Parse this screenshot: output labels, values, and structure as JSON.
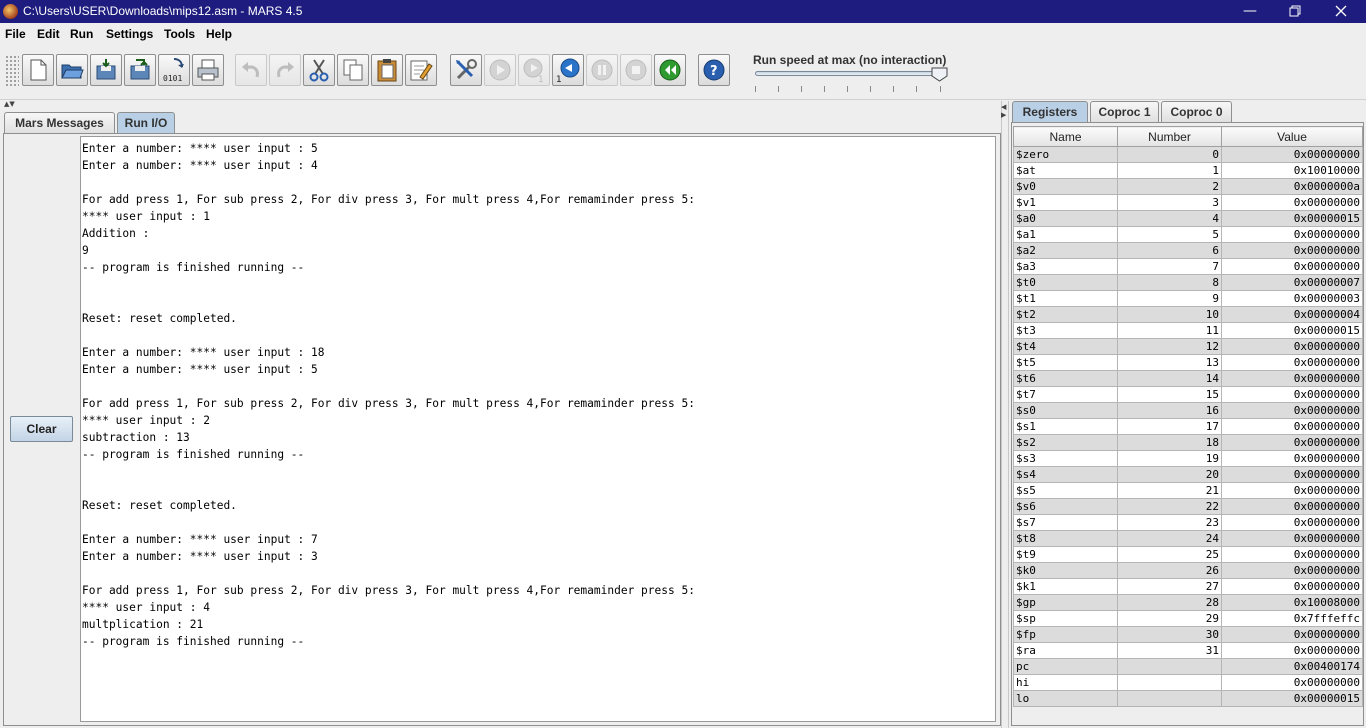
{
  "window": {
    "title": "C:\\Users\\USER\\Downloads\\mips12.asm  - MARS 4.5",
    "controls": [
      "minimize",
      "restore",
      "close"
    ]
  },
  "menu": [
    "File",
    "Edit",
    "Run",
    "Settings",
    "Tools",
    "Help"
  ],
  "toolbar": {
    "buttons": [
      {
        "name": "new-icon",
        "enabled": true
      },
      {
        "name": "open-icon",
        "enabled": true
      },
      {
        "name": "save-icon",
        "enabled": true
      },
      {
        "name": "save-as-icon",
        "enabled": true
      },
      {
        "name": "dump-memory-icon",
        "enabled": true
      },
      {
        "name": "print-icon",
        "enabled": true
      },
      {
        "name": "undo-icon",
        "enabled": false
      },
      {
        "name": "redo-icon",
        "enabled": false
      },
      {
        "name": "cut-icon",
        "enabled": true
      },
      {
        "name": "copy-icon",
        "enabled": true
      },
      {
        "name": "paste-icon",
        "enabled": true
      },
      {
        "name": "find-replace-icon",
        "enabled": true
      },
      {
        "name": "assemble-icon",
        "enabled": true
      },
      {
        "name": "run-icon",
        "enabled": false
      },
      {
        "name": "step-icon",
        "enabled": false
      },
      {
        "name": "backstep-icon",
        "enabled": true
      },
      {
        "name": "pause-icon",
        "enabled": false
      },
      {
        "name": "stop-icon",
        "enabled": false
      },
      {
        "name": "reset-icon",
        "enabled": true
      },
      {
        "name": "help-icon",
        "enabled": true
      }
    ],
    "dump_label": "0101",
    "run_speed_label": "Run speed at max (no interaction)",
    "run_speed_level": 1.0
  },
  "left_tabs": [
    {
      "label": "Mars Messages",
      "active": false
    },
    {
      "label": "Run I/O",
      "active": true
    }
  ],
  "clear_label": "Clear",
  "console_lines": [
    "Enter a number: **** user input : 5",
    "Enter a number: **** user input : 4",
    "",
    "For add press 1, For sub press 2, For div press 3, For mult press 4,For remaminder press 5:",
    "**** user input : 1",
    "Addition :",
    "9",
    "-- program is finished running --",
    "",
    "",
    "Reset: reset completed.",
    "",
    "Enter a number: **** user input : 18",
    "Enter a number: **** user input : 5",
    "",
    "For add press 1, For sub press 2, For div press 3, For mult press 4,For remaminder press 5:",
    "**** user input : 2",
    "subtraction : 13",
    "-- program is finished running --",
    "",
    "",
    "Reset: reset completed.",
    "",
    "Enter a number: **** user input : 7",
    "Enter a number: **** user input : 3",
    "",
    "For add press 1, For sub press 2, For div press 3, For mult press 4,For remaminder press 5:",
    "**** user input : 4",
    "multplication : 21",
    "-- program is finished running --"
  ],
  "right_tabs": [
    {
      "label": "Registers",
      "active": true
    },
    {
      "label": "Coproc 1",
      "active": false
    },
    {
      "label": "Coproc 0",
      "active": false
    }
  ],
  "registers": {
    "headers": [
      "Name",
      "Number",
      "Value"
    ],
    "rows": [
      [
        "$zero",
        "0",
        "0x00000000"
      ],
      [
        "$at",
        "1",
        "0x10010000"
      ],
      [
        "$v0",
        "2",
        "0x0000000a"
      ],
      [
        "$v1",
        "3",
        "0x00000000"
      ],
      [
        "$a0",
        "4",
        "0x00000015"
      ],
      [
        "$a1",
        "5",
        "0x00000000"
      ],
      [
        "$a2",
        "6",
        "0x00000000"
      ],
      [
        "$a3",
        "7",
        "0x00000000"
      ],
      [
        "$t0",
        "8",
        "0x00000007"
      ],
      [
        "$t1",
        "9",
        "0x00000003"
      ],
      [
        "$t2",
        "10",
        "0x00000004"
      ],
      [
        "$t3",
        "11",
        "0x00000015"
      ],
      [
        "$t4",
        "12",
        "0x00000000"
      ],
      [
        "$t5",
        "13",
        "0x00000000"
      ],
      [
        "$t6",
        "14",
        "0x00000000"
      ],
      [
        "$t7",
        "15",
        "0x00000000"
      ],
      [
        "$s0",
        "16",
        "0x00000000"
      ],
      [
        "$s1",
        "17",
        "0x00000000"
      ],
      [
        "$s2",
        "18",
        "0x00000000"
      ],
      [
        "$s3",
        "19",
        "0x00000000"
      ],
      [
        "$s4",
        "20",
        "0x00000000"
      ],
      [
        "$s5",
        "21",
        "0x00000000"
      ],
      [
        "$s6",
        "22",
        "0x00000000"
      ],
      [
        "$s7",
        "23",
        "0x00000000"
      ],
      [
        "$t8",
        "24",
        "0x00000000"
      ],
      [
        "$t9",
        "25",
        "0x00000000"
      ],
      [
        "$k0",
        "26",
        "0x00000000"
      ],
      [
        "$k1",
        "27",
        "0x00000000"
      ],
      [
        "$gp",
        "28",
        "0x10008000"
      ],
      [
        "$sp",
        "29",
        "0x7fffeffc"
      ],
      [
        "$fp",
        "30",
        "0x00000000"
      ],
      [
        "$ra",
        "31",
        "0x00000000"
      ],
      [
        "pc",
        "",
        "0x00400174"
      ],
      [
        "hi",
        "",
        "0x00000000"
      ],
      [
        "lo",
        "",
        "0x00000015"
      ]
    ]
  }
}
